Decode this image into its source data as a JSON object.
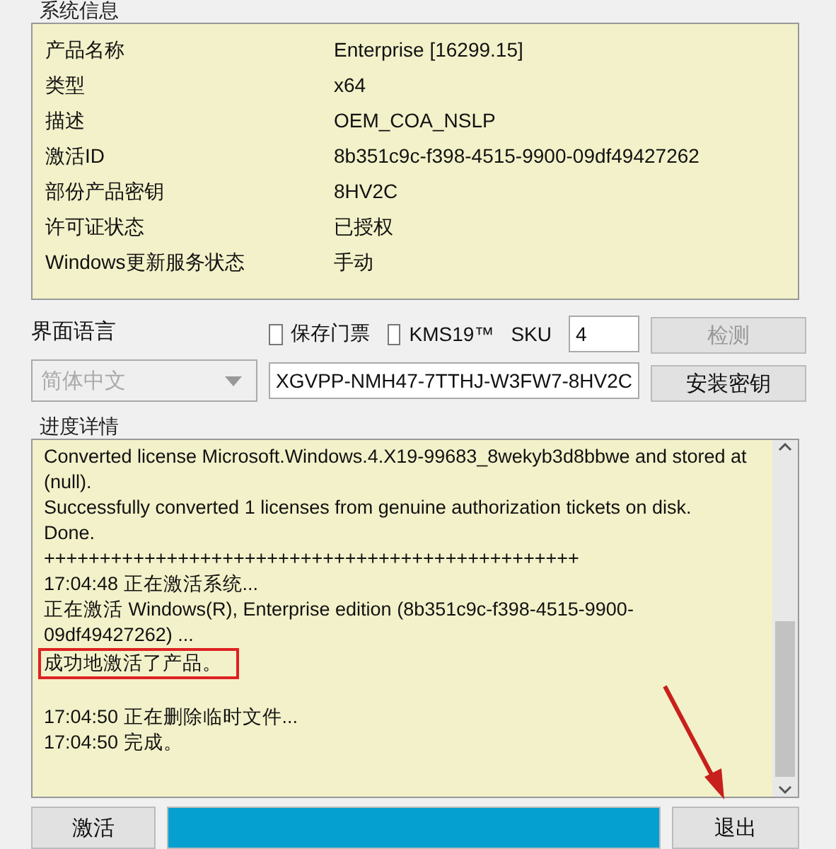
{
  "system_info": {
    "title": "系统信息",
    "rows": [
      {
        "label": "产品名称",
        "value": "Enterprise [16299.15]"
      },
      {
        "label": "类型",
        "value": "x64"
      },
      {
        "label": "描述",
        "value": "OEM_COA_NSLP"
      },
      {
        "label": "激活ID",
        "value": "8b351c9c-f398-4515-9900-09df49427262"
      },
      {
        "label": "部份产品密钥",
        "value": "8HV2C"
      },
      {
        "label": "许可证状态",
        "value": "已授权"
      },
      {
        "label": "Windows更新服务状态",
        "value": "手动"
      }
    ]
  },
  "language": {
    "label": "界面语言",
    "value": "简体中文",
    "disabled": true
  },
  "options": [
    {
      "label": "保存门票",
      "checked": false
    },
    {
      "label": "KMS19™",
      "checked": false
    }
  ],
  "sku": {
    "label": "SKU",
    "value": "4"
  },
  "product_key": {
    "value": "XGVPP-NMH47-7TTHJ-W3FW7-8HV2C"
  },
  "side_buttons": [
    {
      "label": "检测",
      "disabled": true
    },
    {
      "label": "安装密钥",
      "disabled": false
    }
  ],
  "progress": {
    "title": "进度详情",
    "log": [
      {
        "lines": [
          {
            "text": "Converted license Microsoft.Windows.4.X19-99683_8wekyb3d8bbwe and stored at (null).",
            "highlighted": false
          },
          {
            "text": "Successfully converted 1 licenses from genuine authorization tickets on disk.",
            "highlighted": false
          },
          {
            "text": "Done.",
            "highlighted": false
          },
          {
            "text": "++++++++++++++++++++++++++++++++++++++++++++++++",
            "highlighted": false
          },
          {
            "text": "17:04:48 正在激活系统...",
            "highlighted": false
          },
          {
            "text": "正在激活 Windows(R), Enterprise edition (8b351c9c-f398-4515-9900-09df49427262) ...",
            "highlighted": false
          },
          {
            "text": "成功地激活了产品。",
            "highlighted": true
          }
        ]
      },
      {
        "lines": [
          {
            "text": "17:04:50 正在删除临时文件...",
            "highlighted": false
          },
          {
            "text": "17:04:50 完成。",
            "highlighted": false
          }
        ]
      }
    ]
  },
  "bottom": {
    "activate": "激活",
    "exit": "退出",
    "level": 1
  }
}
